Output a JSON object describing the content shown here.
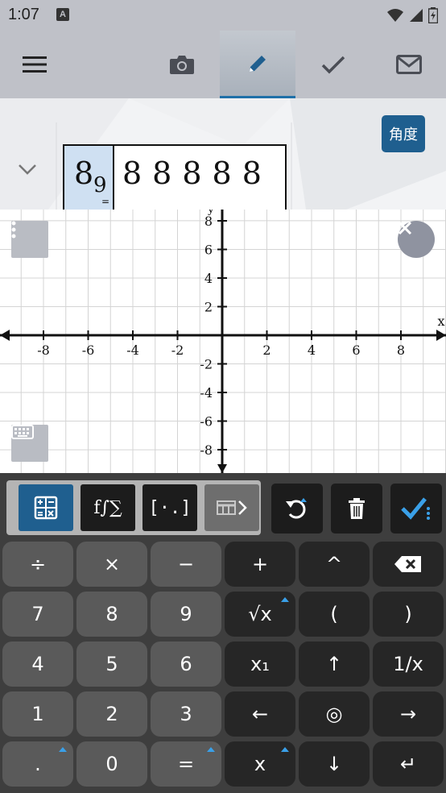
{
  "status_bar": {
    "time": "1:07",
    "a_badge": "A"
  },
  "toolbar": {
    "items": [
      {
        "name": "menu",
        "icon": "hamburger-icon"
      },
      {
        "name": "camera",
        "icon": "camera-icon"
      },
      {
        "name": "pencil",
        "icon": "pencil-icon",
        "active": true
      },
      {
        "name": "check",
        "icon": "checkmark-icon"
      },
      {
        "name": "mail",
        "icon": "mail-icon"
      }
    ]
  },
  "input": {
    "angle_label": "角度",
    "expr_base": "8",
    "expr_sub": "9",
    "expr_eq": "=",
    "expr_rest": "88888"
  },
  "graph": {
    "x_axis_label": "x",
    "y_axis_label": "y",
    "x_ticks": [
      "-8",
      "-6",
      "-4",
      "-2",
      "2",
      "4",
      "6",
      "8"
    ],
    "y_ticks": [
      "8",
      "6",
      "4",
      "2",
      "-2",
      "-4",
      "-6",
      "-8"
    ]
  },
  "keypad": {
    "modes": [
      "calculator-icon",
      "f∫∑",
      "[·.]",
      "more-icon"
    ],
    "rows": [
      [
        "÷",
        "×",
        "−",
        "+",
        "^",
        "⌫"
      ],
      [
        "7",
        "8",
        "9",
        "√x",
        "(",
        ")"
      ],
      [
        "4",
        "5",
        "6",
        "x₁",
        "↑",
        "1/x"
      ],
      [
        "1",
        "2",
        "3",
        "←",
        "◎",
        "→"
      ],
      [
        ".",
        "0",
        "=",
        "x",
        "↓",
        "↵"
      ]
    ]
  },
  "colors": {
    "accent": "#1f70a8",
    "keypad_bg": "#3e3e3e",
    "key": "#5a5a5a",
    "key_dark": "#262626",
    "toolbar": "#bfc1c8"
  }
}
